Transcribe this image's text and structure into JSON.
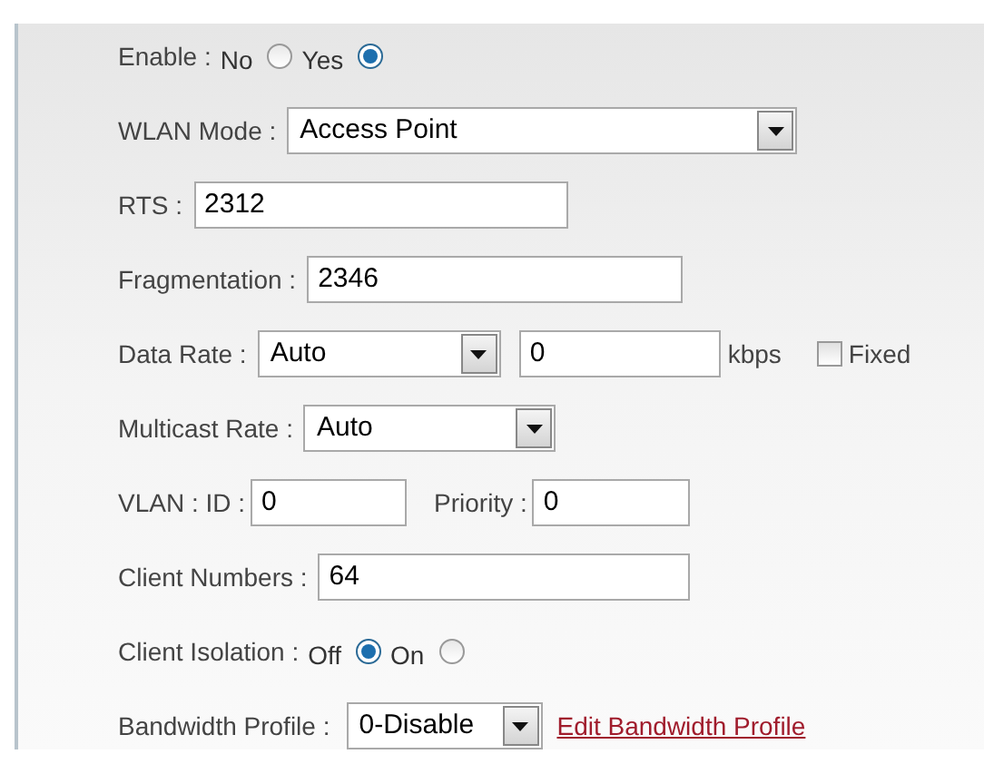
{
  "rows": [
    {
      "kind": "radio",
      "label": "Enable :",
      "options": [
        {
          "label": "No",
          "selected": false
        },
        {
          "label": "Yes",
          "selected": true
        }
      ]
    },
    {
      "kind": "select",
      "label": "WLAN Mode :",
      "value": "Access Point"
    },
    {
      "kind": "input",
      "label": "RTS :",
      "value": "2312"
    },
    {
      "kind": "input",
      "label": "Fragmentation :",
      "value": "2346"
    },
    {
      "kind": "data_rate",
      "label": "Data Rate :",
      "value": "Auto",
      "rate": "0",
      "unit": "kbps",
      "fixed": {
        "label": "Fixed",
        "checked": false
      }
    },
    {
      "kind": "select",
      "label": "Multicast Rate :",
      "value": "Auto"
    },
    {
      "kind": "vlan",
      "label": "VLAN : ID :",
      "value": "0",
      "priority_label": "Priority :",
      "priority": "0"
    },
    {
      "kind": "input",
      "label": "Client Numbers :",
      "value": "64"
    },
    {
      "kind": "radio",
      "label": "Client Isolation :",
      "options": [
        {
          "label": "Off",
          "selected": true
        },
        {
          "label": "On",
          "selected": false
        }
      ]
    },
    {
      "kind": "select_link",
      "label": "Bandwidth Profile :",
      "value": "0-Disable",
      "link": "Edit Bandwidth Profile"
    }
  ]
}
